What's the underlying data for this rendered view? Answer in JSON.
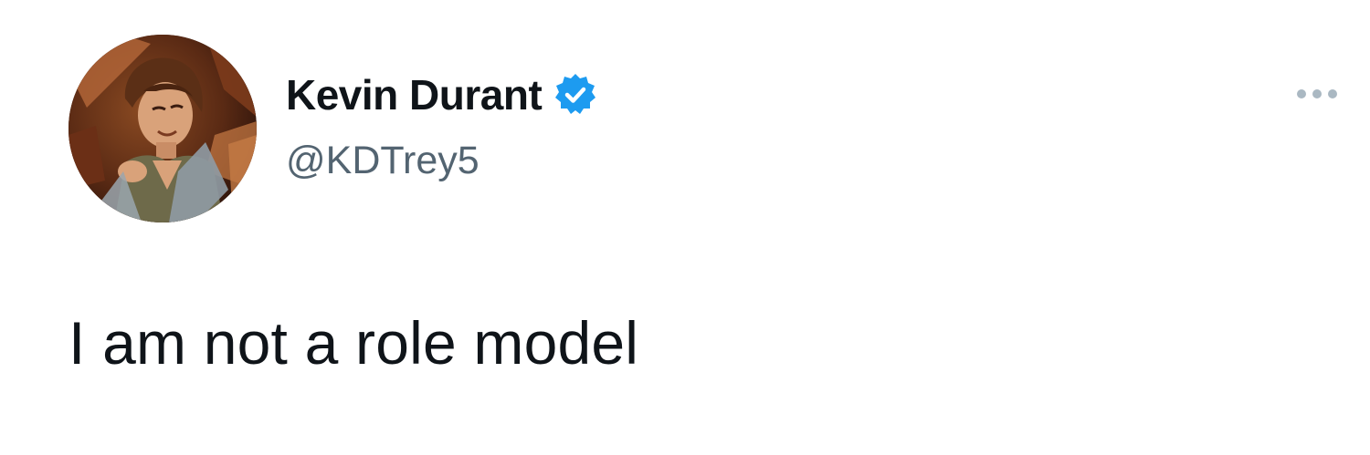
{
  "tweet": {
    "author": {
      "display_name": "Kevin Durant",
      "handle": "@KDTrey5",
      "verified": true
    },
    "text": "I am not a role model",
    "menu_icon": "more-horizontal-icon",
    "avatar_icon": "profile-avatar"
  },
  "colors": {
    "text": "#0f1419",
    "handle": "#536471",
    "verified_badge": "#1d9bf0",
    "menu_dots": "#aab8c2"
  }
}
